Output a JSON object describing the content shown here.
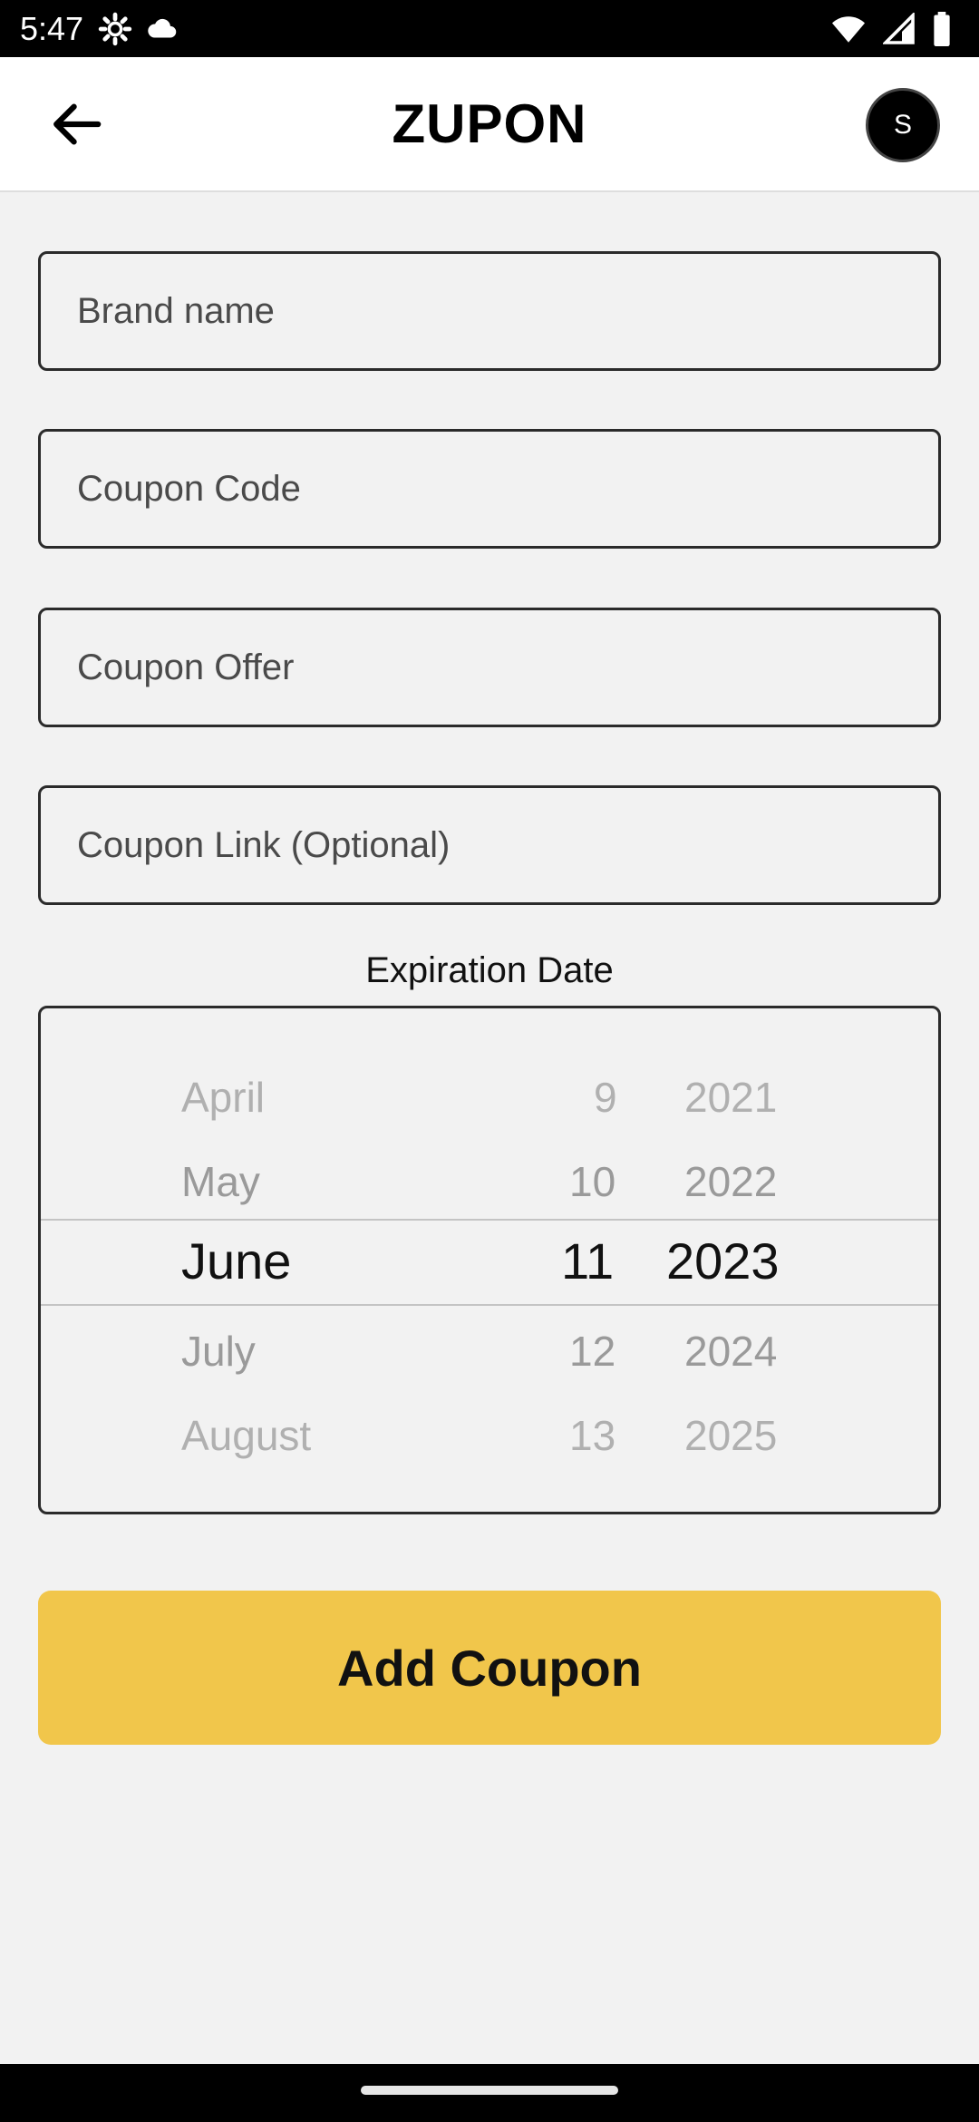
{
  "status_bar": {
    "time": "5:47",
    "left_icons": [
      "settings-icon",
      "cloud-icon"
    ],
    "right_icons": [
      "wifi-icon",
      "signal-icon",
      "battery-icon"
    ]
  },
  "app_bar": {
    "title": "ZUPON",
    "avatar_initial": "S"
  },
  "form": {
    "brand_name": {
      "placeholder": "Brand name",
      "value": ""
    },
    "coupon_code": {
      "placeholder": "Coupon Code",
      "value": ""
    },
    "coupon_offer": {
      "placeholder": "Coupon Offer",
      "value": ""
    },
    "coupon_link": {
      "placeholder": "Coupon Link (Optional)",
      "value": ""
    }
  },
  "expiration": {
    "label": "Expiration Date",
    "months": [
      "April",
      "May",
      "June",
      "July",
      "August"
    ],
    "days": [
      "9",
      "10",
      "11",
      "12",
      "13"
    ],
    "years": [
      "2021",
      "2022",
      "2023",
      "2024",
      "2025"
    ],
    "selected": {
      "month": "June",
      "day": "11",
      "year": "2023"
    }
  },
  "actions": {
    "add_coupon_label": "Add Coupon",
    "accent_color": "#f1c64b"
  }
}
